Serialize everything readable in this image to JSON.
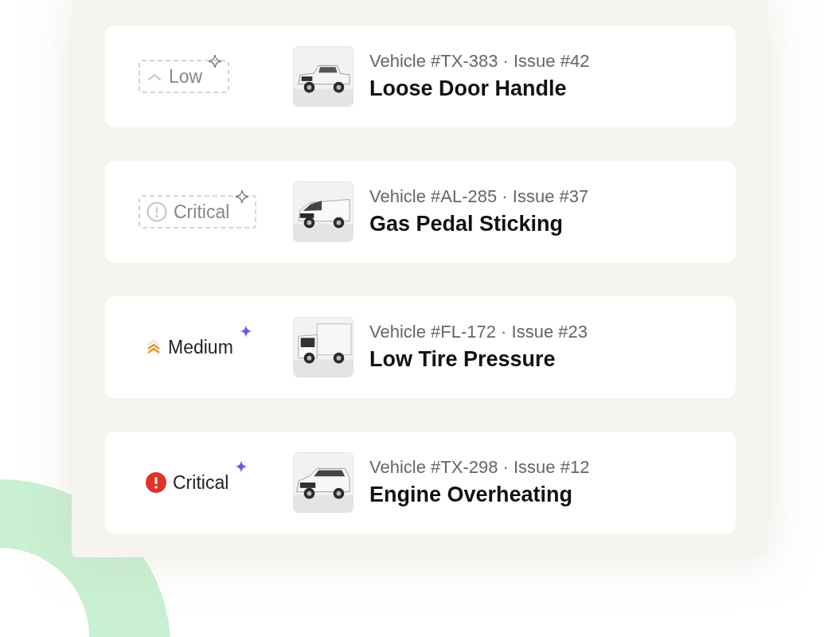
{
  "issues": [
    {
      "priority": {
        "kind": "low",
        "label": "Low"
      },
      "confirmed": false,
      "vehicle": {
        "kind": "pickup"
      },
      "subtitle": "Vehicle #TX-383 · Issue #42",
      "title": "Loose Door Handle"
    },
    {
      "priority": {
        "kind": "critical",
        "label": "Critical"
      },
      "confirmed": false,
      "vehicle": {
        "kind": "van"
      },
      "subtitle": "Vehicle #AL-285 · Issue #37",
      "title": "Gas Pedal Sticking"
    },
    {
      "priority": {
        "kind": "medium",
        "label": "Medium"
      },
      "confirmed": true,
      "vehicle": {
        "kind": "truck"
      },
      "subtitle": "Vehicle #FL-172 · Issue #23",
      "title": "Low Tire Pressure"
    },
    {
      "priority": {
        "kind": "critical",
        "label": "Critical"
      },
      "confirmed": true,
      "vehicle": {
        "kind": "suv"
      },
      "subtitle": "Vehicle #TX-298 · Issue #12",
      "title": "Engine Overheating"
    }
  ]
}
